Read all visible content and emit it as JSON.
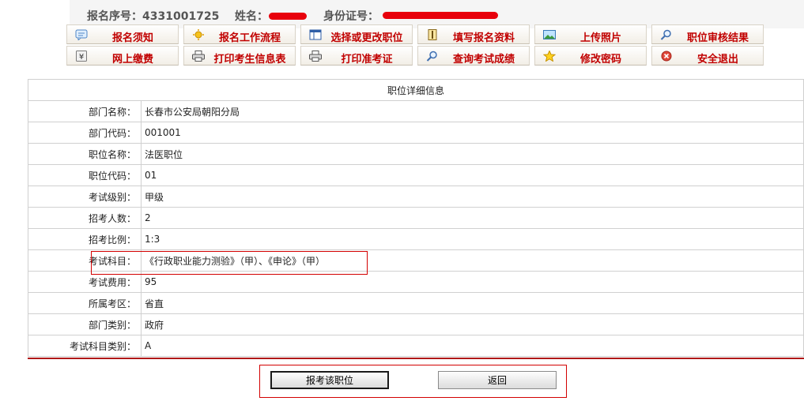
{
  "header": {
    "reg_no_label": "报名序号：",
    "reg_no": "4331001725",
    "name_label": "姓名：",
    "id_label": "身份证号："
  },
  "nav": [
    {
      "label": "报名须知",
      "icon": "notice-icon"
    },
    {
      "label": "报名工作流程",
      "icon": "flow-icon"
    },
    {
      "label": "选择或更改职位",
      "icon": "window-icon"
    },
    {
      "label": "填写报名资料",
      "icon": "form-icon"
    },
    {
      "label": "上传照片",
      "icon": "image-icon"
    },
    {
      "label": "职位审核结果",
      "icon": "magnifier-icon"
    },
    {
      "label": "网上缴费",
      "icon": "yen-icon"
    },
    {
      "label": "打印考生信息表",
      "icon": "printer-icon"
    },
    {
      "label": "打印准考证",
      "icon": "printer-icon"
    },
    {
      "label": "查询考试成绩",
      "icon": "magnifier-icon"
    },
    {
      "label": "修改密码",
      "icon": "star-icon"
    },
    {
      "label": "安全退出",
      "icon": "exit-icon"
    }
  ],
  "detail": {
    "title": "职位详细信息",
    "rows": [
      {
        "label": "部门名称：",
        "value": "长春市公安局朝阳分局"
      },
      {
        "label": "部门代码：",
        "value": "001001"
      },
      {
        "label": "职位名称：",
        "value": "法医职位"
      },
      {
        "label": "职位代码：",
        "value": "01"
      },
      {
        "label": "考试级别：",
        "value": "甲级"
      },
      {
        "label": "招考人数：",
        "value": "2"
      },
      {
        "label": "招考比例：",
        "value": "1:3"
      },
      {
        "label": "考试科目：",
        "value": "《行政职业能力测验》（甲）、《申论》（甲）"
      },
      {
        "label": "考试费用：",
        "value": "95"
      },
      {
        "label": "所属考区：",
        "value": "省直"
      },
      {
        "label": "部门类别：",
        "value": "政府"
      },
      {
        "label": "考试科目类别：",
        "value": "A"
      }
    ]
  },
  "actions": {
    "apply_label": "报考该职位",
    "back_label": "返回"
  },
  "colors": {
    "nav_text": "#c10000",
    "highlight": "#d30000",
    "divider": "#b01818",
    "redaction": "#e8000c"
  }
}
